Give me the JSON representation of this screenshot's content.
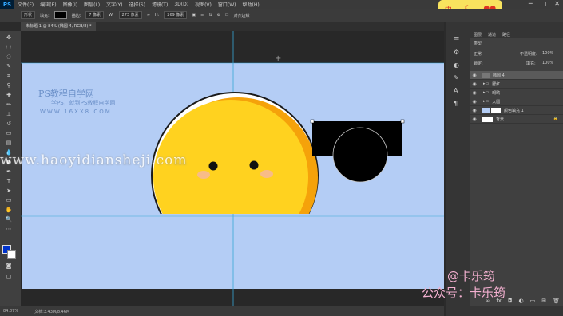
{
  "app": {
    "logo": "PS"
  },
  "menubar": {
    "items": [
      "文件(F)",
      "编辑(E)",
      "图像(I)",
      "图层(L)",
      "文字(Y)",
      "选择(S)",
      "滤镜(T)",
      "3D(D)",
      "视图(V)",
      "窗口(W)",
      "帮助(H)"
    ]
  },
  "options": {
    "shape_mode": "形状",
    "fill_label": "填充:",
    "stroke_label": "描边:",
    "stroke_size": "7 像素",
    "w_label": "W:",
    "w_value": "273 像素",
    "h_label": "H:",
    "h_value": "269 像素",
    "align_edges": "对齐边缘"
  },
  "document": {
    "tab_title": "未标题-1 @ 84% (椭圆 4, RGB/8) *"
  },
  "ime": {
    "label": "中"
  },
  "layers_panel": {
    "tabs": [
      "图层",
      "通道",
      "路径"
    ],
    "kind_filter": "类型",
    "blend_mode": "正常",
    "opacity_label": "不透明度:",
    "opacity_value": "100%",
    "lock_label": "锁定:",
    "fill_label": "填充:",
    "fill_value": "100%",
    "rows": [
      {
        "name": "椭圆 4"
      },
      {
        "name": "腮红"
      },
      {
        "name": "眼睛"
      },
      {
        "name": "大圆"
      },
      {
        "name": "颜色填充 1"
      },
      {
        "name": "背景"
      }
    ]
  },
  "status": {
    "zoom": "84.07%",
    "doc": "文档:3.43M/8.46M"
  },
  "watermarks": {
    "site_cn": "PS教程自学网",
    "slogan": "学PS，就到PS教程自学网",
    "site_url": "WWW.16XX8.COM",
    "overlay_url": "www.haoyidiansheji.com"
  },
  "credit": {
    "line1": "@卡乐筠",
    "line2": "公众号：卡乐筠"
  },
  "colors": {
    "artboard": "#b4cdf5",
    "face": "#ffd21f",
    "face_shade": "#f5a20a",
    "blush": "#f6b7a3",
    "black_shape": "#000000"
  }
}
